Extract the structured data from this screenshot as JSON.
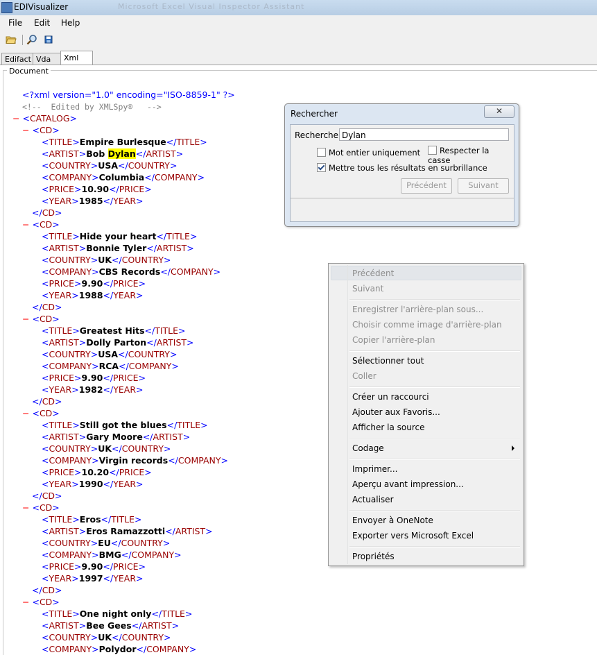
{
  "app": {
    "title": "EDIVisualizer",
    "ghost_title": "Microsoft Excel Visual Inspector Assistant"
  },
  "menu": {
    "file": "File",
    "edit": "Edit",
    "help": "Help"
  },
  "toolbar": {
    "icons": [
      "open-folder-icon",
      "find-icon",
      "save-icon"
    ]
  },
  "tabs": [
    {
      "label": "Edifact"
    },
    {
      "label": "Vda"
    },
    {
      "label": "Xml"
    }
  ],
  "document_label": "Document",
  "xml": {
    "declaration": "<?xml version=\"1.0\" encoding=\"ISO-8859-1\" ?>",
    "comment": "<!--  Edited by XMLSpy®   -->",
    "catalog_tag": "CATALOG",
    "cd_tag": "CD",
    "collapse_marker": "−",
    "field_tags": {
      "title": "TITLE",
      "artist": "ARTIST",
      "country": "COUNTRY",
      "company": "COMPANY",
      "price": "PRICE",
      "year": "YEAR"
    },
    "cds": [
      {
        "title": "Empire Burlesque",
        "artist_prefix": "Bob ",
        "artist_hl": "Dylan",
        "artist": "Bob Dylan",
        "country": "USA",
        "company": "Columbia",
        "price": "10.90",
        "year": "1985"
      },
      {
        "title": "Hide your heart",
        "artist": "Bonnie Tyler",
        "country": "UK",
        "company": "CBS Records",
        "price": "9.90",
        "year": "1988"
      },
      {
        "title": "Greatest Hits",
        "artist": "Dolly Parton",
        "country": "USA",
        "company": "RCA",
        "price": "9.90",
        "year": "1982"
      },
      {
        "title": "Still got the blues",
        "artist": "Gary Moore",
        "country": "UK",
        "company": "Virgin records",
        "price": "10.20",
        "year": "1990"
      },
      {
        "title": "Eros",
        "artist": "Eros Ramazzotti",
        "country": "EU",
        "company": "BMG",
        "price": "9.90",
        "year": "1997"
      },
      {
        "title": "One night only",
        "artist": "Bee Gees",
        "country": "UK",
        "company": "Polydor"
      }
    ]
  },
  "find_dialog": {
    "title": "Rechercher",
    "search_label": "Rechercher :",
    "search_value": "Dylan",
    "whole_word": {
      "label": "Mot entier uniquement",
      "checked": false
    },
    "match_case": {
      "label": "Respecter la casse",
      "checked": false
    },
    "highlight_all": {
      "label": "Mettre tous les résultats en surbrillance",
      "checked": true
    },
    "prev_button": "Précédent",
    "next_button": "Suivant",
    "close_glyph": "✕"
  },
  "context_menu": {
    "items": [
      {
        "label": "Précédent",
        "enabled": false
      },
      {
        "label": "Suivant",
        "enabled": false
      },
      {
        "label": "Enregistrer l'arrière-plan sous...",
        "enabled": false
      },
      {
        "label": "Choisir comme image d'arrière-plan",
        "enabled": false
      },
      {
        "label": "Copier l'arrière-plan",
        "enabled": false
      },
      {
        "label": "Sélectionner tout",
        "enabled": true
      },
      {
        "label": "Coller",
        "enabled": false
      },
      {
        "label": "Créer un raccourci",
        "enabled": true
      },
      {
        "label": "Ajouter aux Favoris...",
        "enabled": true
      },
      {
        "label": "Afficher la source",
        "enabled": true
      },
      {
        "label": "Codage",
        "enabled": true,
        "submenu": true
      },
      {
        "label": "Imprimer...",
        "enabled": true
      },
      {
        "label": "Aperçu avant impression...",
        "enabled": true
      },
      {
        "label": "Actualiser",
        "enabled": true
      },
      {
        "label": "Envoyer à OneNote",
        "enabled": true
      },
      {
        "label": "Exporter vers Microsoft Excel",
        "enabled": true
      },
      {
        "label": "Propriétés",
        "enabled": true
      }
    ]
  }
}
